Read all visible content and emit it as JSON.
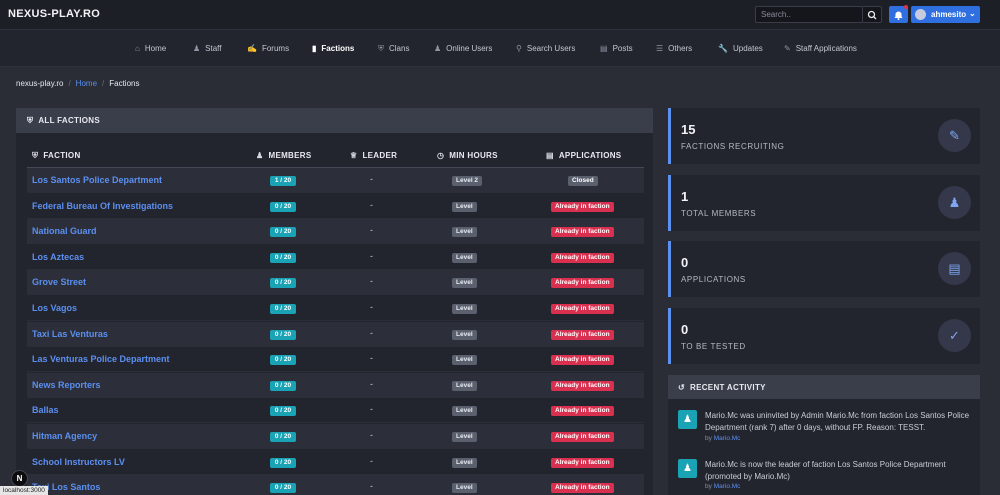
{
  "brand": "NEXUS-PLAY.RO",
  "search": {
    "placeholder": "Search.."
  },
  "user": {
    "name": "ahmesito"
  },
  "nav": [
    {
      "label": "Home",
      "icon": "home-icon"
    },
    {
      "label": "Staff",
      "icon": "staff-icon"
    },
    {
      "label": "Forums",
      "icon": "forums-icon"
    },
    {
      "label": "Factions",
      "icon": "factions-icon",
      "active": true
    },
    {
      "label": "Clans",
      "icon": "shield-icon"
    },
    {
      "label": "Online Users",
      "icon": "users-icon"
    },
    {
      "label": "Search Users",
      "icon": "search-icon"
    },
    {
      "label": "Posts",
      "icon": "posts-icon"
    },
    {
      "label": "Others",
      "icon": "list-icon"
    },
    {
      "label": "Updates",
      "icon": "wrench-icon"
    },
    {
      "label": "Staff Applications",
      "icon": "clipboard-icon"
    }
  ],
  "breadcrumb": {
    "site": "nexus-play.ro",
    "home": "Home",
    "current": "Factions"
  },
  "factions_panel": {
    "title": "ALL FACTIONS",
    "columns": {
      "faction": "FACTION",
      "members": "MEMBERS",
      "leader": "LEADER",
      "min_hours": "MIN HOURS",
      "applications": "APPLICATIONS"
    },
    "rows": [
      {
        "name": "Los Santos Police Department",
        "members": "1 / 20",
        "leader": "-",
        "min_hours": "Level 2",
        "applications": "Closed"
      },
      {
        "name": "Federal Bureau Of Investigations",
        "members": "0 / 20",
        "leader": "-",
        "min_hours": "Level",
        "applications": "Already in faction"
      },
      {
        "name": "National Guard",
        "members": "0 / 20",
        "leader": "-",
        "min_hours": "Level",
        "applications": "Already in faction"
      },
      {
        "name": "Los Aztecas",
        "members": "0 / 20",
        "leader": "-",
        "min_hours": "Level",
        "applications": "Already in faction"
      },
      {
        "name": "Grove Street",
        "members": "0 / 20",
        "leader": "-",
        "min_hours": "Level",
        "applications": "Already in faction"
      },
      {
        "name": "Los Vagos",
        "members": "0 / 20",
        "leader": "-",
        "min_hours": "Level",
        "applications": "Already in faction"
      },
      {
        "name": "Taxi Las Venturas",
        "members": "0 / 20",
        "leader": "-",
        "min_hours": "Level",
        "applications": "Already in faction"
      },
      {
        "name": "Las Venturas Police Department",
        "members": "0 / 20",
        "leader": "-",
        "min_hours": "Level",
        "applications": "Already in faction"
      },
      {
        "name": "News Reporters",
        "members": "0 / 20",
        "leader": "-",
        "min_hours": "Level",
        "applications": "Already in faction"
      },
      {
        "name": "Ballas",
        "members": "0 / 20",
        "leader": "-",
        "min_hours": "Level",
        "applications": "Already in faction"
      },
      {
        "name": "Hitman Agency",
        "members": "0 / 20",
        "leader": "-",
        "min_hours": "Level",
        "applications": "Already in faction"
      },
      {
        "name": "School Instructors LV",
        "members": "0 / 20",
        "leader": "-",
        "min_hours": "Level",
        "applications": "Already in faction"
      },
      {
        "name": "Taxi Los Santos",
        "members": "0 / 20",
        "leader": "-",
        "min_hours": "Level",
        "applications": "Already in faction"
      }
    ]
  },
  "stats": [
    {
      "value": "15",
      "label": "FACTIONS RECRUITING",
      "icon": "user-edit-icon"
    },
    {
      "value": "1",
      "label": "TOTAL MEMBERS",
      "icon": "users-icon"
    },
    {
      "value": "0",
      "label": "APPLICATIONS",
      "icon": "file-icon"
    },
    {
      "value": "0",
      "label": "TO BE TESTED",
      "icon": "clipboard-check-icon"
    }
  ],
  "activity": {
    "title": "RECENT ACTIVITY",
    "items": [
      {
        "text": "Mario.Mc was uninvited by Admin Mario.Mc from faction Los Santos Police Department (rank 7) after 0 days, without FP. Reason: TESST.",
        "by_prefix": "by",
        "by": "Mario.Mc"
      },
      {
        "text": "Mario.Mc is now the leader of faction Los Santos Police Department (promoted by Mario.Mc)",
        "by_prefix": "by",
        "by": "Mario.Mc"
      }
    ]
  },
  "dev": {
    "badge": "N",
    "status_url": "localhost:3000"
  },
  "colors": {
    "accent": "#5b8ff0",
    "primary_button": "#2f6fe0",
    "members_badge": "#1aa3b5",
    "danger_badge": "#d9304f",
    "muted_badge": "#5b606f"
  }
}
